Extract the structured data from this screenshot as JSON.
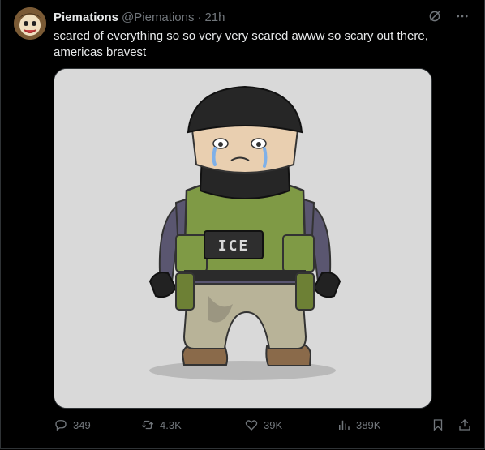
{
  "post": {
    "author_name": "Piemations",
    "handle": "@Piemations",
    "separator": "·",
    "time": "21h",
    "text": "scared of everything so so very very scared awww so scary out there, americas bravest"
  },
  "media": {
    "vest_label": "ICE"
  },
  "actions": {
    "replies": "349",
    "reposts": "4.3K",
    "likes": "39K",
    "views": "389K"
  },
  "icons": {
    "grok": "slashed-circle-icon",
    "more": "more-dots-icon",
    "reply": "speech-bubble-icon",
    "repost": "repost-arrows-icon",
    "like": "heart-icon",
    "views": "bar-chart-icon",
    "bookmark": "bookmark-icon",
    "share": "share-upload-icon"
  },
  "colors": {
    "background": "#000000",
    "text": "#e7e9ea",
    "muted": "#71767b",
    "border": "#2f3336"
  }
}
